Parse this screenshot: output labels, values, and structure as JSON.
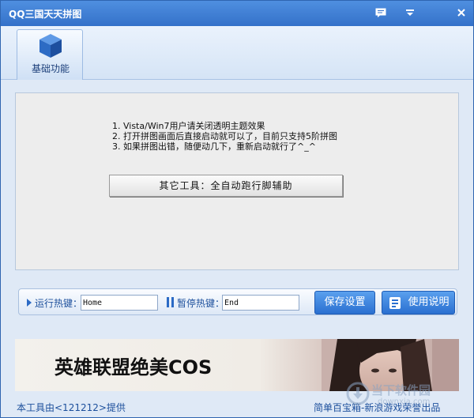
{
  "window": {
    "title": "QQ三国天天拼图",
    "icons": [
      "feedback-icon",
      "menu-dropdown-icon",
      "close-icon"
    ]
  },
  "tabs": [
    {
      "label": "基础功能",
      "icon": "cube-icon",
      "selected": true
    }
  ],
  "notes": [
    "1. Vista/Win7用户请关闭透明主题效果",
    "2. 打开拼图画面后直接启动就可以了，目前只支持5阶拼图",
    "3. 如果拼图出错，随便动几下，重新启动就行了^_^"
  ],
  "tool_button": {
    "label": "其它工具：全自动跑行脚辅助"
  },
  "hotkeys": {
    "run_label": "运行热键：",
    "run_value": "Home",
    "pause_label": "暂停热键：",
    "pause_value": "End"
  },
  "buttons": {
    "save": "保存设置",
    "help": "使用说明"
  },
  "banner": {
    "text": "英雄联盟绝美COS"
  },
  "footer": {
    "credit_left": "本工具由<121212>提供",
    "credit_right": "简单百宝箱-新浪游戏荣誉出品"
  },
  "watermark": {
    "text": "当下软件园",
    "sub": "downxia.com"
  },
  "colors": {
    "titlebar": "#3f80d6",
    "accent_button": "#3a82de",
    "link_text": "#1c4f9c"
  }
}
